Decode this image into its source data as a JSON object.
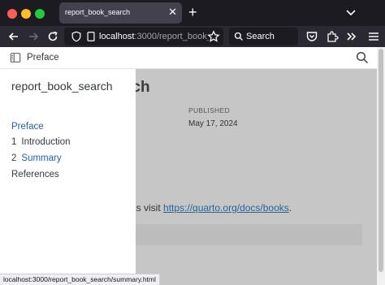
{
  "tabs": [
    {
      "title": "report_book_search",
      "active": true
    }
  ],
  "url": {
    "host": "localhost",
    "rest": ":3000/report_book_"
  },
  "search": {
    "placeholder": "Search"
  },
  "page": {
    "topbar_title": "Preface",
    "main_title_fragment": "rch",
    "published_label": "PUBLISHED",
    "published_date": "May 17, 2024",
    "para_prefix": "oks visit ",
    "para_link": "https://quarto.org/docs/books",
    "para_suffix": "."
  },
  "sidebar": {
    "title": "report_book_search",
    "items": [
      {
        "num": "",
        "label": "Preface",
        "active": true
      },
      {
        "num": "1",
        "label": "Introduction",
        "active": false
      },
      {
        "num": "2",
        "label": "Summary",
        "active": false,
        "accent": true
      },
      {
        "num": "",
        "label": "References",
        "active": false
      }
    ]
  },
  "status": {
    "url": "localhost:3000/report_book_search/summary.html"
  },
  "colors": {
    "accent": "#2761a3",
    "overlay": "#c6c6c6"
  }
}
